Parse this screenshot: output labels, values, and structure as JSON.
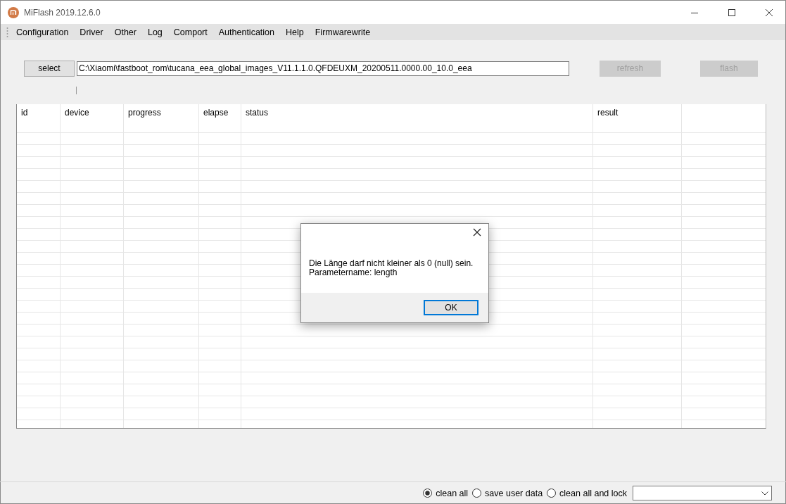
{
  "window": {
    "title": "MiFlash 2019.12.6.0"
  },
  "menu": [
    "Configuration",
    "Driver",
    "Other",
    "Log",
    "Comport",
    "Authentication",
    "Help",
    "Firmwarewrite"
  ],
  "toolbar": {
    "select_button": {
      "label": "select",
      "disabled": false
    },
    "path_field": {
      "value": "C:\\Xiaomi\\fastboot_rom\\tucana_eea_global_images_V11.1.1.0.QFDEUXM_20200511.0000.00_10.0_eea"
    },
    "buttons": [
      {
        "label": "refresh",
        "disabled": true
      },
      {
        "label": "flash",
        "disabled": true
      }
    ]
  },
  "table": {
    "columns": [
      "id",
      "device",
      "progress",
      "elapse",
      "status",
      "result"
    ]
  },
  "dialog": {
    "message_lines": [
      "Die Länge darf nicht kleiner als 0 (null) sein.",
      "Parametername: length"
    ],
    "button": "OK"
  },
  "options": [
    {
      "label": "clean all",
      "selected": true
    },
    {
      "label": "save user data",
      "selected": false
    },
    {
      "label": "clean all and lock",
      "selected": false
    }
  ]
}
